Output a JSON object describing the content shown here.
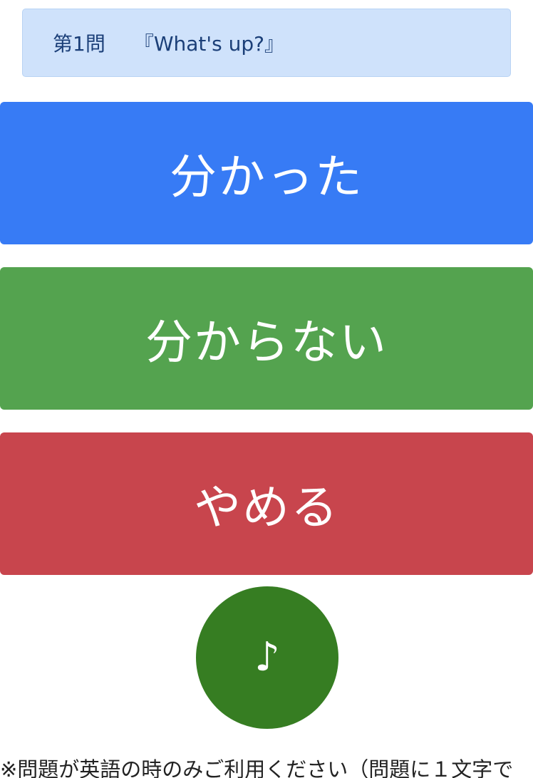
{
  "question": {
    "number": "第1問",
    "text": "『What's up?』"
  },
  "buttons": {
    "know_label": "分かった",
    "dont_know_label": "分からない",
    "quit_label": "やめる"
  },
  "sound": {
    "icon": "music-note-icon",
    "glyph": "♪"
  },
  "note": {
    "text": "※問題が英語の時のみご利用ください（問題に１文字で"
  },
  "colors": {
    "question_bg": "#cfe2fb",
    "question_text": "#1b3f78",
    "know": "#377bf5",
    "dont_know": "#54a34f",
    "quit": "#c8454d",
    "sound": "#367d22"
  }
}
